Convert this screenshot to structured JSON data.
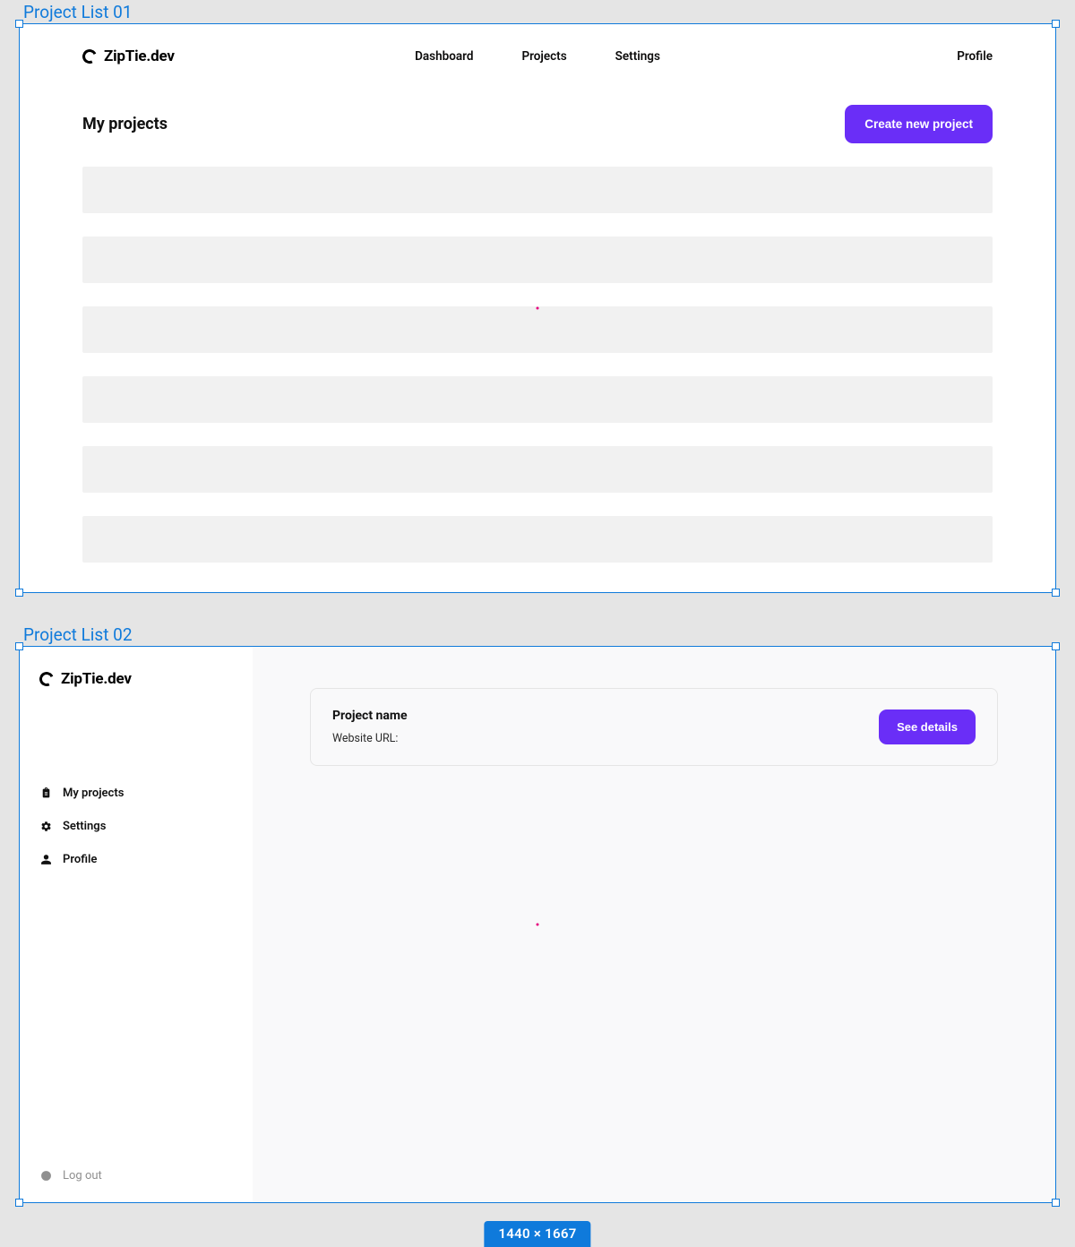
{
  "canvas": {
    "artboard1_label": "Project List 01",
    "artboard2_label": "Project List 02",
    "dimensions_badge": "1440 × 1667",
    "accent": "#6a2ef7",
    "selection_color": "#0f7adb"
  },
  "brand": {
    "name": "ZipTie.dev"
  },
  "artboard1": {
    "nav": {
      "center": [
        "Dashboard",
        "Projects",
        "Settings"
      ],
      "right": "Profile"
    },
    "page_title": "My projects",
    "cta_label": "Create new project",
    "placeholder_rows": 6
  },
  "artboard2": {
    "sidebar": {
      "items": [
        {
          "icon": "clipboard-icon",
          "label": "My projects"
        },
        {
          "icon": "gear-icon",
          "label": "Settings"
        },
        {
          "icon": "person-icon",
          "label": "Profile"
        }
      ],
      "logout_label": "Log out"
    },
    "card": {
      "name_label": "Project name",
      "url_label": "Website URL:",
      "details_button": "See details"
    }
  }
}
